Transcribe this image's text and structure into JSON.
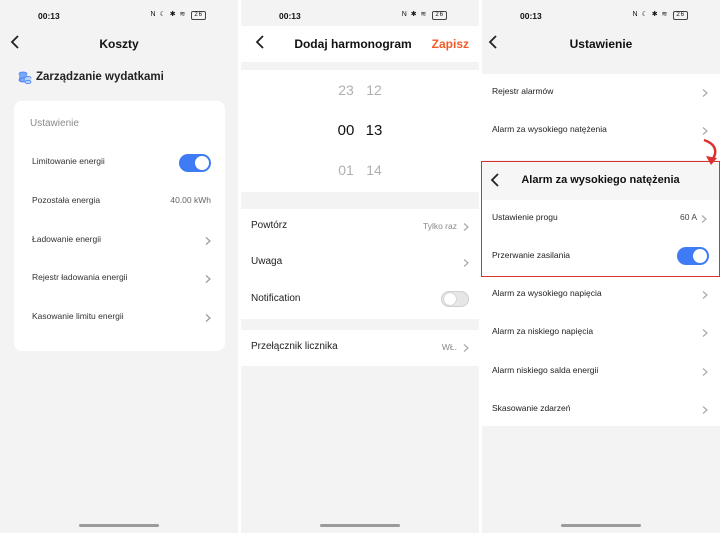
{
  "status": {
    "time": "00:13",
    "battery": "26"
  },
  "panel1": {
    "title": "Koszty",
    "section_title": "Zarządzanie wydatkami",
    "card_label": "Ustawienie",
    "rows": [
      {
        "label": "Limitowanie energii",
        "toggle": true
      },
      {
        "label": "Pozostała energia",
        "value": "40.00 kWh"
      },
      {
        "label": "Ładowanie energii"
      },
      {
        "label": "Rejestr ładowania energii"
      },
      {
        "label": "Kasowanie limitu energii"
      }
    ]
  },
  "panel2": {
    "title": "Dodaj harmonogram",
    "save": "Zapisz",
    "picker": {
      "above": {
        "hour": "23",
        "minute": "12"
      },
      "selected": {
        "hour": "00",
        "minute": "13"
      },
      "below": {
        "hour": "01",
        "minute": "14"
      }
    },
    "repeat": {
      "label": "Powtórz",
      "value": "Tylko raz"
    },
    "note": {
      "label": "Uwaga"
    },
    "notification": {
      "label": "Notification",
      "toggle": false
    },
    "meter_switch": {
      "label": "Przełącznik licznika",
      "value": "WŁ."
    }
  },
  "panel3": {
    "title": "Ustawienie",
    "alarm_log": "Rejestr alarmów",
    "high_current_alarm": "Alarm za wysokiego natężenia",
    "sub": {
      "title": "Alarm za wysokiego natężenia",
      "threshold": {
        "label": "Ustawienie progu",
        "value": "60 A"
      },
      "power_cut": {
        "label": "Przerwanie zasilania",
        "toggle": true
      }
    },
    "rows": [
      {
        "label": "Alarm  za wysokiego napięcia"
      },
      {
        "label": "Alarm za niskiego napięcia"
      },
      {
        "label": "Alarm niskiego salda energii"
      },
      {
        "label": "Skasowanie zdarzeń"
      }
    ]
  },
  "colors": {
    "accent": "#3e7bf5",
    "save": "#f05a28",
    "highlight": "#d93030"
  },
  "icons": [
    "back-arrow-icon",
    "chevron-right-icon",
    "coins-icon",
    "toggle-switch"
  ]
}
